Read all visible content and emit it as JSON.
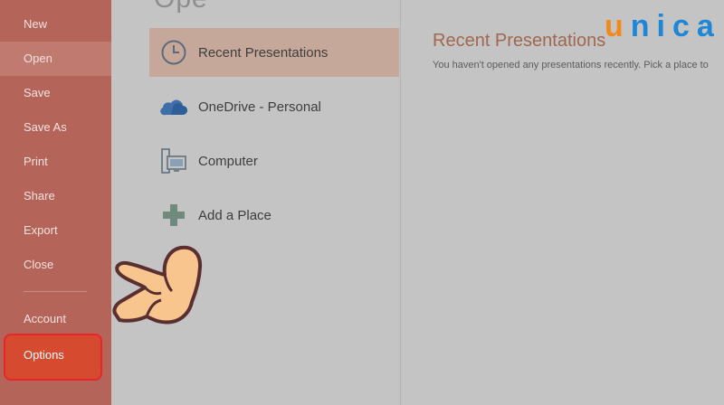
{
  "sidebar": {
    "items": [
      {
        "label": "New"
      },
      {
        "label": "Open"
      },
      {
        "label": "Save"
      },
      {
        "label": "Save As"
      },
      {
        "label": "Print"
      },
      {
        "label": "Share"
      },
      {
        "label": "Export"
      },
      {
        "label": "Close"
      },
      {
        "label": "Account"
      },
      {
        "label": "Options"
      }
    ],
    "active": "Open",
    "highlighted": "Options"
  },
  "page": {
    "heading": "Ope"
  },
  "places": {
    "items": [
      {
        "label": "Recent Presentations",
        "icon": "clock-icon"
      },
      {
        "label": "OneDrive - Personal",
        "icon": "cloud-icon"
      },
      {
        "label": "Computer",
        "icon": "computer-icon"
      },
      {
        "label": "Add a Place",
        "icon": "plus-icon"
      }
    ]
  },
  "recent": {
    "title": "Recent Presentations",
    "message": "You haven't opened any presentations recently. Pick a place to"
  },
  "logo": {
    "first": "u",
    "rest": "nica"
  },
  "colors": {
    "sidebar": "#b5645a",
    "options_highlight": "#d64a2f",
    "options_border": "#e8262a",
    "logo_orange": "#f08a1e",
    "logo_blue": "#1e86d6"
  }
}
